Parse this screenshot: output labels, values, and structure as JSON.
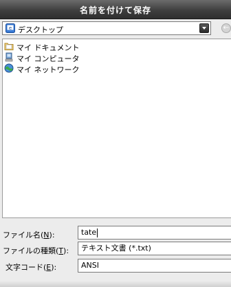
{
  "window": {
    "title": "名前を付けて保存"
  },
  "toolbar": {
    "location": "デスクトップ"
  },
  "files": [
    {
      "label": "マイ ドキュメント",
      "icon": "my-documents-icon"
    },
    {
      "label": "マイ コンピュータ",
      "icon": "my-computer-icon"
    },
    {
      "label": "マイ ネットワーク",
      "icon": "my-network-icon"
    }
  ],
  "form": {
    "filename_label": "ファイル名",
    "filename_key": "N",
    "filename_value": "tate",
    "filetype_label": "ファイルの種類",
    "filetype_key": "T",
    "filetype_value": "テキスト文書 (*.txt)",
    "encoding_label": "文字コード",
    "encoding_key": "E",
    "encoding_value": "ANSI"
  },
  "colors": {
    "titlebar": "#3f3f3f",
    "list_bg": "#ffffff",
    "window_bg": "#ececec"
  }
}
